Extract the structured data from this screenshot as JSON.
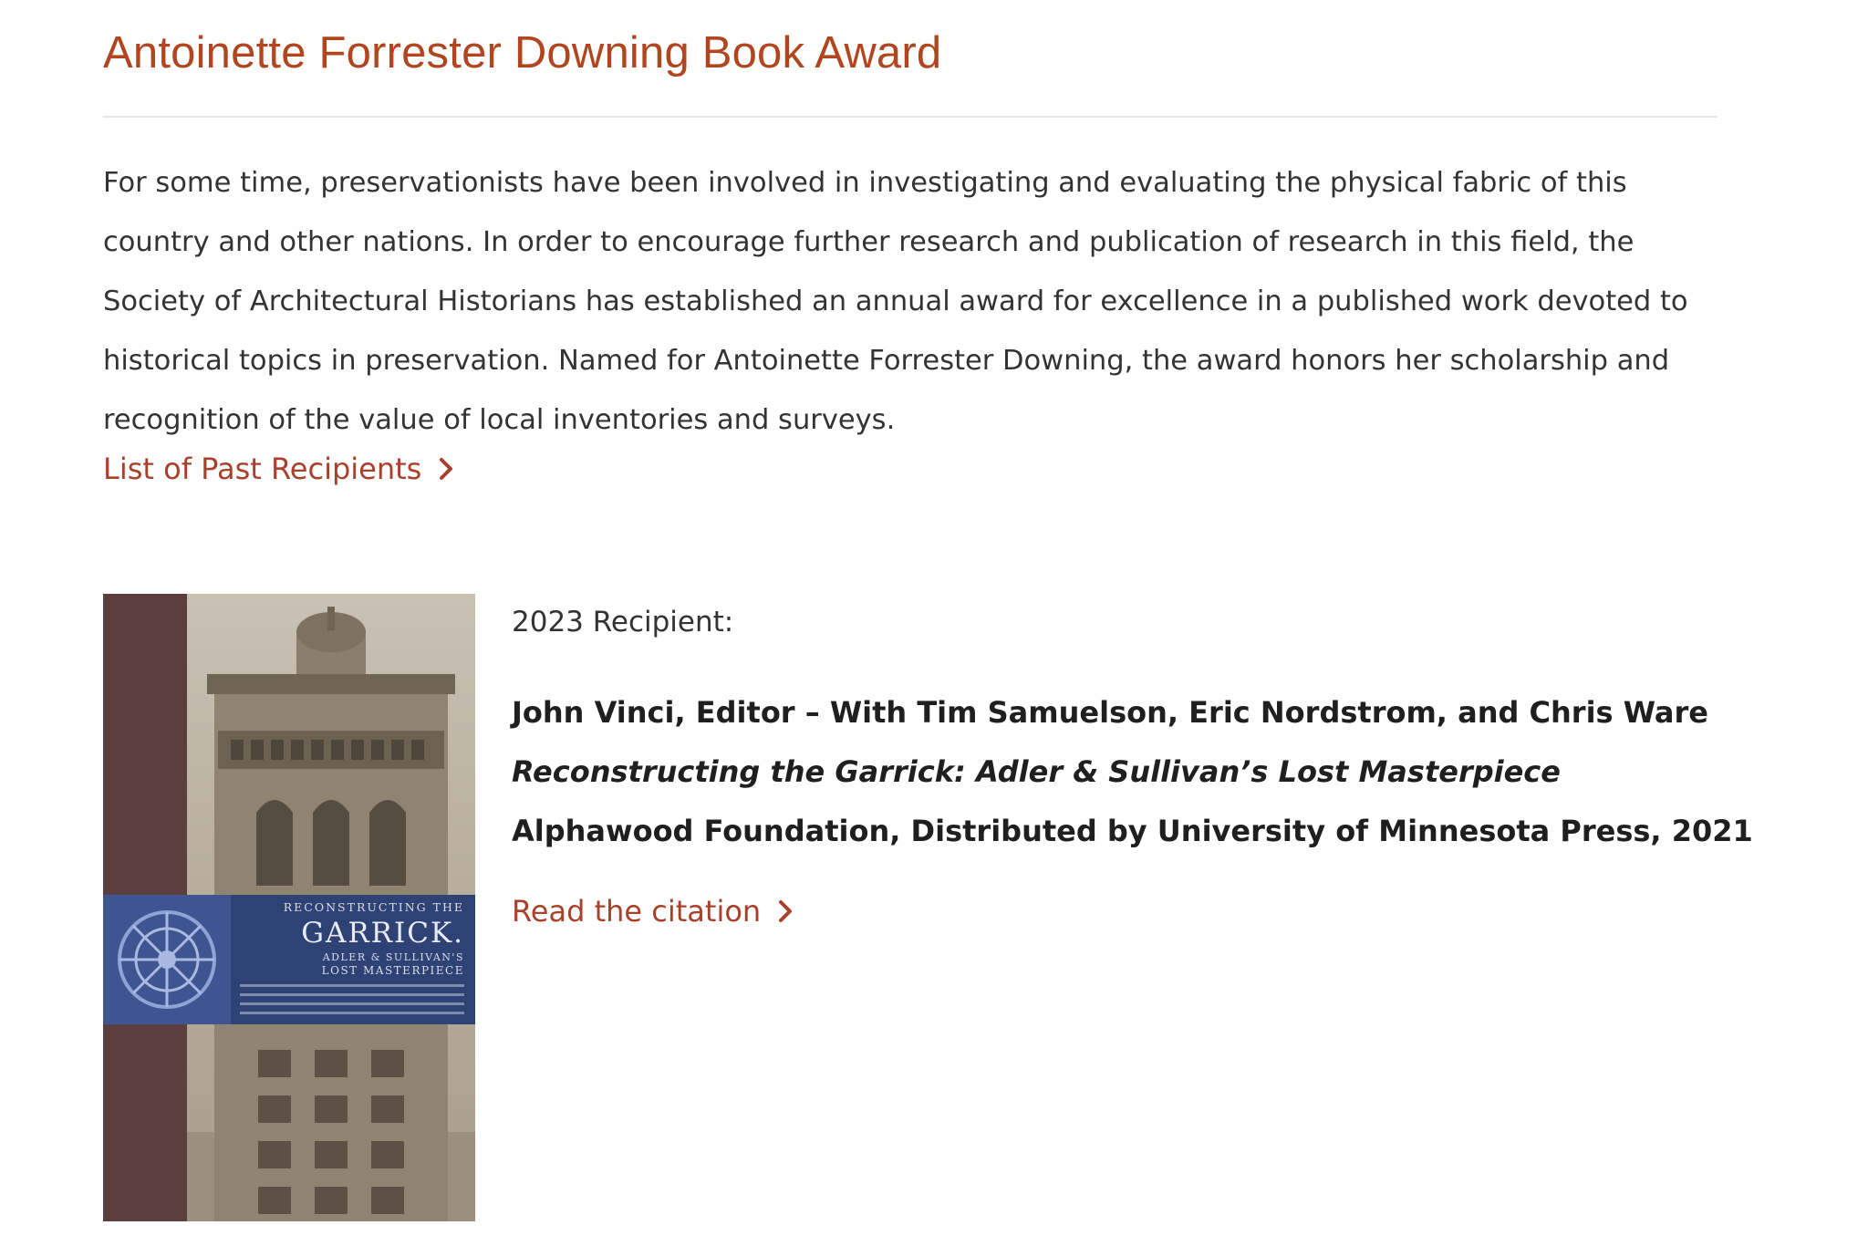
{
  "header": {
    "title": "Antoinette Forrester Downing Book Award"
  },
  "intro": {
    "paragraph": "For some time, preservationists have been involved in investigating and evaluating the physical fabric of this country and other nations. In order to encourage further research and publication of research in this field, the Society of Architectural Historians has established an annual award for excellence in a published work devoted to historical topics in preservation. Named for Antoinette Forrester Downing, the award honors her scholarship and recognition of the value of local inventories and surveys.",
    "past_link": "List of Past Recipients",
    "link_icon": "chevron-right-icon"
  },
  "recipient": {
    "label": "2023 Recipient:",
    "authors": "John Vinci, Editor – With Tim Samuelson, Eric Nordstrom, and Chris Ware",
    "book_title": "Reconstructing the Garrick: Adler & Sullivan’s Lost Masterpiece",
    "publisher": "Alphawood Foundation, Distributed by University of Minnesota Press, 2021",
    "citation_link": "Read the citation"
  },
  "cover": {
    "line1": "RECONSTRUCTING THE",
    "line2": "GARRICK.",
    "line3": "ADLER & SULLIVAN'S",
    "line4": "LOST MASTERPIECE"
  },
  "colors": {
    "title": "#b0451f",
    "link": "#a8412b",
    "text": "#333333",
    "cover_spine": "#5c3e3e",
    "cover_band": "#2f4276"
  }
}
